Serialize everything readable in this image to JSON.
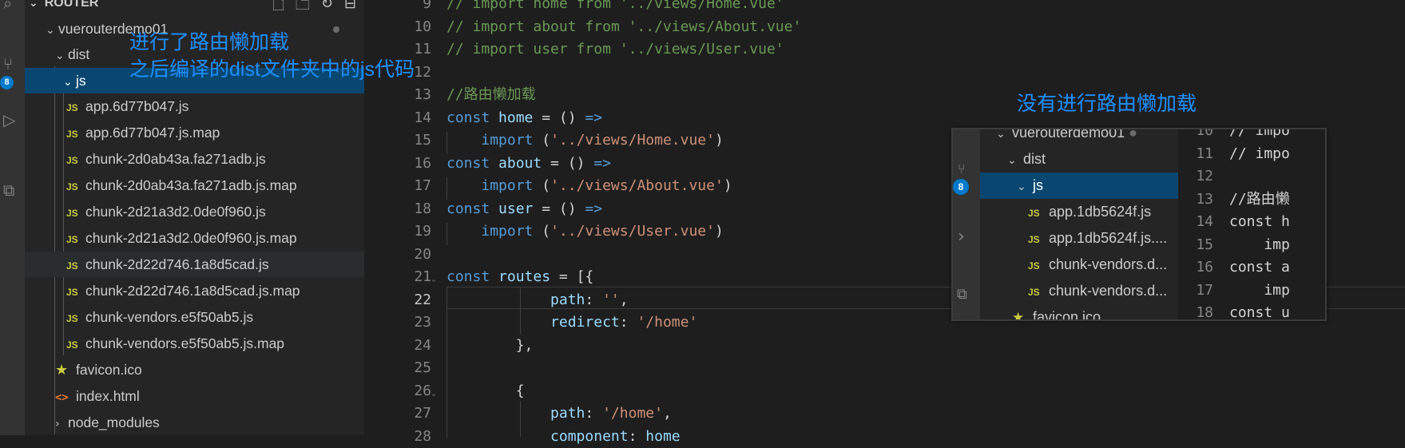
{
  "sidebar": {
    "section_title": "ROUTER",
    "actions": [
      "new-file-icon",
      "new-folder-icon",
      "refresh-icon",
      "collapse-all-icon"
    ],
    "badge": "8",
    "tree": {
      "project": "vuerouterdemo01",
      "dist": "dist",
      "js": "js",
      "files": [
        "app.6d77b047.js",
        "app.6d77b047.js.map",
        "chunk-2d0ab43a.fa271adb.js",
        "chunk-2d0ab43a.fa271adb.js.map",
        "chunk-2d21a3d2.0de0f960.js",
        "chunk-2d21a3d2.0de0f960.js.map",
        "chunk-2d22d746.1a8d5cad.js",
        "chunk-2d22d746.1a8d5cad.js.map",
        "chunk-vendors.e5f50ab5.js",
        "chunk-vendors.e5f50ab5.js.map"
      ],
      "js_badge": "JS",
      "favicon": "favicon.ico",
      "index": "index.html",
      "node_modules": "node_modules"
    }
  },
  "annotations": {
    "left_line1": "进行了路由懒加载",
    "left_line2": "之后编译的dist文件夹中的js代码",
    "right_title": "没有进行路由懒加载"
  },
  "editor": {
    "line_numbers": [
      "9",
      "10",
      "11",
      "12",
      "13",
      "14",
      "15",
      "16",
      "17",
      "18",
      "19",
      "20",
      "21",
      "22",
      "23",
      "24",
      "25",
      "26",
      "27",
      "28"
    ],
    "active_line": "22"
  },
  "inset": {
    "badge": "8",
    "project": "vuerouterdemo01",
    "dist": "dist",
    "js": "js",
    "files": [
      "app.1db5624f.js",
      "app.1db5624f.js....",
      "chunk-vendors.d...",
      "chunk-vendors.d..."
    ],
    "favicon": "favicon.ico",
    "line_numbers": [
      "10",
      "11",
      "12",
      "13",
      "14",
      "15",
      "16",
      "17",
      "18"
    ],
    "code_fragments": [
      "// impo",
      "// impo",
      "",
      "//路由懒",
      "const h",
      "    imp",
      "const a",
      "    imp",
      "const u"
    ]
  }
}
